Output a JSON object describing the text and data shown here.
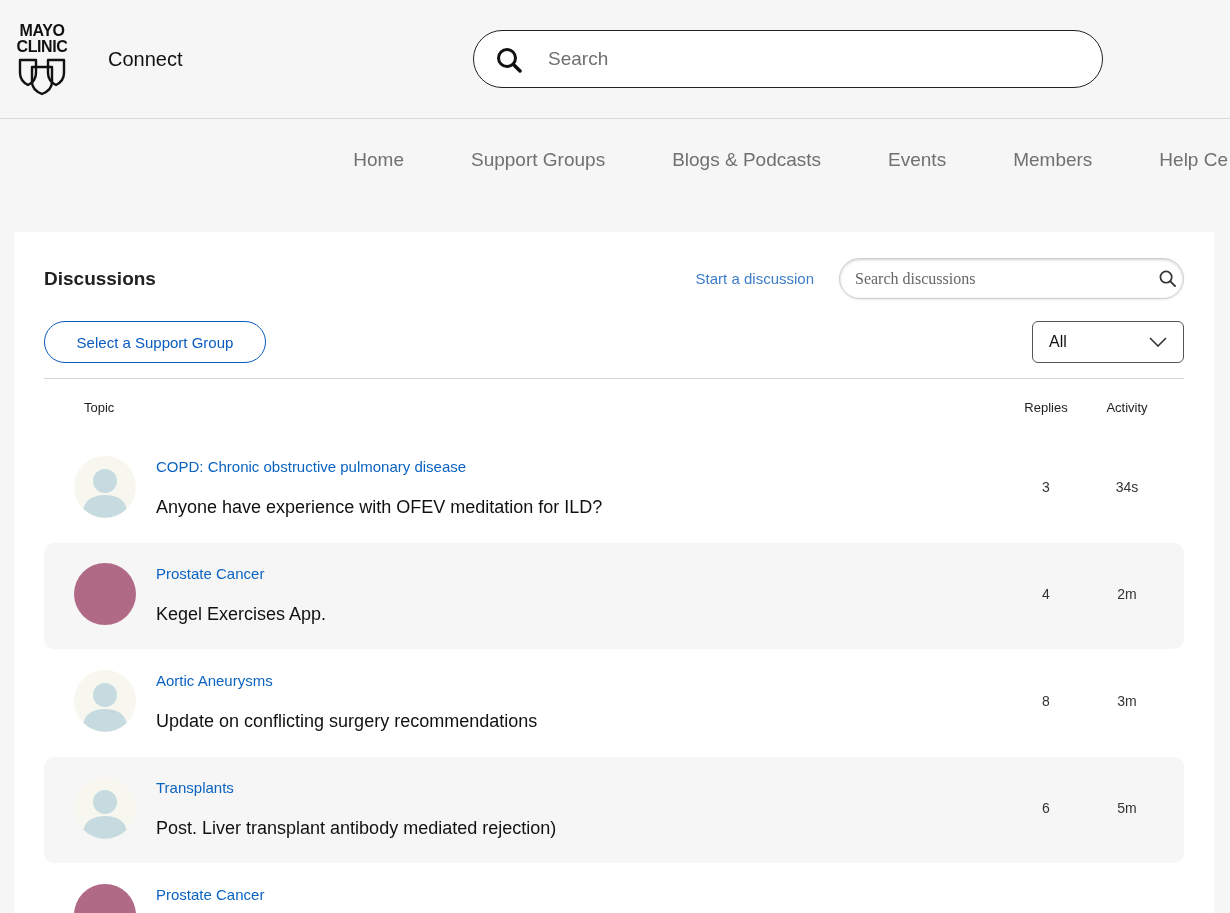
{
  "header": {
    "logo_text": "MAYO CLINIC",
    "site_name": "Connect",
    "search": {
      "placeholder": "Search"
    }
  },
  "nav": [
    "Home",
    "Support Groups",
    "Blogs & Podcasts",
    "Events",
    "Members",
    "Help Ce"
  ],
  "discussions": {
    "title": "Discussions",
    "start_link": "Start a discussion",
    "search": {
      "placeholder": "Search discussions"
    },
    "group_button": "Select a Support Group",
    "filter": {
      "value": "All"
    },
    "columns": [
      "Topic",
      "Replies",
      "Activity"
    ],
    "rows": [
      {
        "avatar": {
          "kind": "silhouette"
        },
        "group": "COPD: Chronic obstructive pulmonary disease",
        "title": "Anyone have experience with OFEV meditation for ILD?",
        "replies": "3",
        "activity": "34s"
      },
      {
        "avatar": {
          "kind": "photo"
        },
        "group": "Prostate Cancer",
        "title": "Kegel Exercises App.",
        "replies": "4",
        "activity": "2m"
      },
      {
        "avatar": {
          "kind": "silhouette"
        },
        "group": "Aortic Aneurysms",
        "title": "Update on conflicting surgery recommendations",
        "replies": "8",
        "activity": "3m"
      },
      {
        "avatar": {
          "kind": "silhouette"
        },
        "group": "Transplants",
        "title": "Post. Liver transplant antibody mediated rejection)",
        "replies": "6",
        "activity": "5m"
      },
      {
        "avatar": {
          "kind": "photo"
        },
        "group": "Prostate Cancer"
      }
    ]
  }
}
